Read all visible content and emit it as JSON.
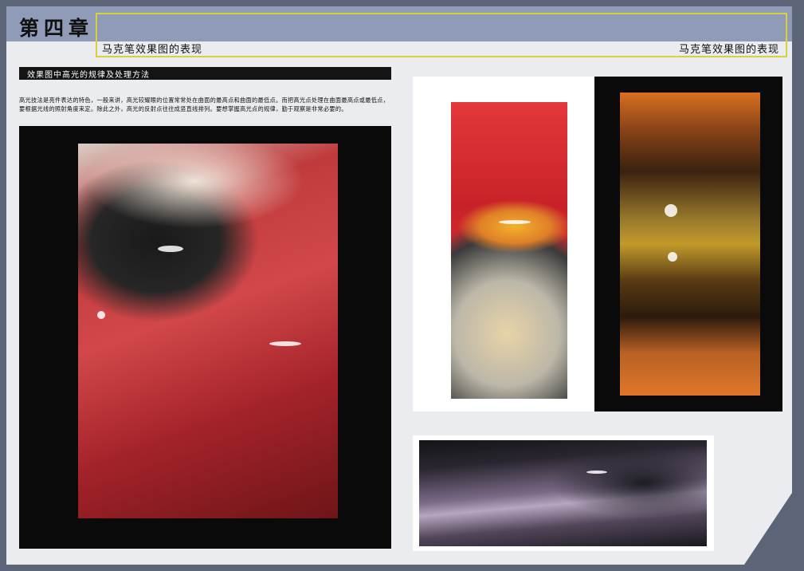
{
  "header": {
    "chapter_title": "第四章",
    "subtitle_left": "马克笔效果图的表现",
    "subtitle_right": "马克笔效果图的表现"
  },
  "section": {
    "heading": "效果图中高光的规律及处理方法",
    "body": "高光技法是亮件表达的特色，一般来讲，高光较耀眼的位置常常处在曲面的最高点和曲面的最低点。而把高光点处理在曲面最高点或最低点，要根据光线的照射角度来定。除此之外，高光的反射点往往成竖直线排列。要想掌握高光点的规律，勤于观察是非常必要的。"
  },
  "colors": {
    "header_band": "#8f9bb7",
    "frame_accent": "#d8d23a",
    "page_background": "#eaecf0",
    "border_background": "#5c6478"
  }
}
